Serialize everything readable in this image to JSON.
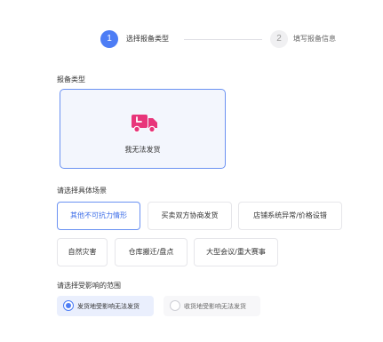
{
  "steps": [
    {
      "number": "1",
      "label": "选择报备类型"
    },
    {
      "number": "2",
      "label": "填写报备信息"
    }
  ],
  "report_type": {
    "section_label": "报备类型",
    "card_label": "我无法发货",
    "icon": "delivery-truck-icon",
    "accent_color": "#e8357a"
  },
  "scenario": {
    "section_label": "请选择具体场景",
    "options": [
      "其他不可抗力情形",
      "买卖双方协商发货",
      "店铺系统异常/价格设错",
      "自然灾害",
      "仓库搬迁/盘点",
      "大型会议/重大赛事"
    ],
    "selected": "其他不可抗力情形"
  },
  "range": {
    "section_label": "请选择受影响的范围",
    "options": [
      "发货地受影响无法发货",
      "收货地受影响无法发货"
    ],
    "selected": "发货地受影响无法发货"
  },
  "colors": {
    "primary": "#4d7df5",
    "border_selected": "#6b92f2"
  }
}
